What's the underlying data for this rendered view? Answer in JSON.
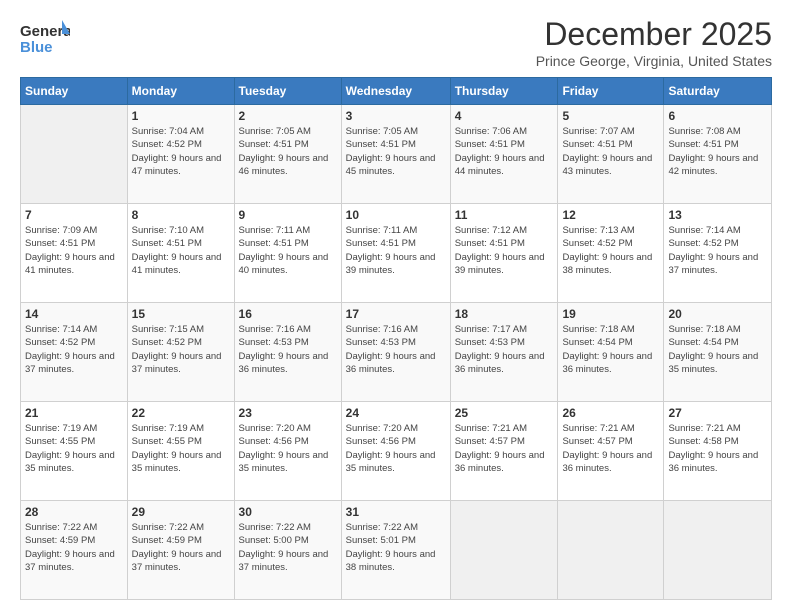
{
  "logo": {
    "line1": "General",
    "line2": "Blue"
  },
  "header": {
    "title": "December 2025",
    "subtitle": "Prince George, Virginia, United States"
  },
  "days_of_week": [
    "Sunday",
    "Monday",
    "Tuesday",
    "Wednesday",
    "Thursday",
    "Friday",
    "Saturday"
  ],
  "weeks": [
    [
      {
        "day": "",
        "empty": true
      },
      {
        "day": "1",
        "sunrise": "7:04 AM",
        "sunset": "4:52 PM",
        "daylight": "9 hours and 47 minutes."
      },
      {
        "day": "2",
        "sunrise": "7:05 AM",
        "sunset": "4:51 PM",
        "daylight": "9 hours and 46 minutes."
      },
      {
        "day": "3",
        "sunrise": "7:05 AM",
        "sunset": "4:51 PM",
        "daylight": "9 hours and 45 minutes."
      },
      {
        "day": "4",
        "sunrise": "7:06 AM",
        "sunset": "4:51 PM",
        "daylight": "9 hours and 44 minutes."
      },
      {
        "day": "5",
        "sunrise": "7:07 AM",
        "sunset": "4:51 PM",
        "daylight": "9 hours and 43 minutes."
      },
      {
        "day": "6",
        "sunrise": "7:08 AM",
        "sunset": "4:51 PM",
        "daylight": "9 hours and 42 minutes."
      }
    ],
    [
      {
        "day": "7",
        "sunrise": "7:09 AM",
        "sunset": "4:51 PM",
        "daylight": "9 hours and 41 minutes."
      },
      {
        "day": "8",
        "sunrise": "7:10 AM",
        "sunset": "4:51 PM",
        "daylight": "9 hours and 41 minutes."
      },
      {
        "day": "9",
        "sunrise": "7:11 AM",
        "sunset": "4:51 PM",
        "daylight": "9 hours and 40 minutes."
      },
      {
        "day": "10",
        "sunrise": "7:11 AM",
        "sunset": "4:51 PM",
        "daylight": "9 hours and 39 minutes."
      },
      {
        "day": "11",
        "sunrise": "7:12 AM",
        "sunset": "4:51 PM",
        "daylight": "9 hours and 39 minutes."
      },
      {
        "day": "12",
        "sunrise": "7:13 AM",
        "sunset": "4:52 PM",
        "daylight": "9 hours and 38 minutes."
      },
      {
        "day": "13",
        "sunrise": "7:14 AM",
        "sunset": "4:52 PM",
        "daylight": "9 hours and 37 minutes."
      }
    ],
    [
      {
        "day": "14",
        "sunrise": "7:14 AM",
        "sunset": "4:52 PM",
        "daylight": "9 hours and 37 minutes."
      },
      {
        "day": "15",
        "sunrise": "7:15 AM",
        "sunset": "4:52 PM",
        "daylight": "9 hours and 37 minutes."
      },
      {
        "day": "16",
        "sunrise": "7:16 AM",
        "sunset": "4:53 PM",
        "daylight": "9 hours and 36 minutes."
      },
      {
        "day": "17",
        "sunrise": "7:16 AM",
        "sunset": "4:53 PM",
        "daylight": "9 hours and 36 minutes."
      },
      {
        "day": "18",
        "sunrise": "7:17 AM",
        "sunset": "4:53 PM",
        "daylight": "9 hours and 36 minutes."
      },
      {
        "day": "19",
        "sunrise": "7:18 AM",
        "sunset": "4:54 PM",
        "daylight": "9 hours and 36 minutes."
      },
      {
        "day": "20",
        "sunrise": "7:18 AM",
        "sunset": "4:54 PM",
        "daylight": "9 hours and 35 minutes."
      }
    ],
    [
      {
        "day": "21",
        "sunrise": "7:19 AM",
        "sunset": "4:55 PM",
        "daylight": "9 hours and 35 minutes."
      },
      {
        "day": "22",
        "sunrise": "7:19 AM",
        "sunset": "4:55 PM",
        "daylight": "9 hours and 35 minutes."
      },
      {
        "day": "23",
        "sunrise": "7:20 AM",
        "sunset": "4:56 PM",
        "daylight": "9 hours and 35 minutes."
      },
      {
        "day": "24",
        "sunrise": "7:20 AM",
        "sunset": "4:56 PM",
        "daylight": "9 hours and 35 minutes."
      },
      {
        "day": "25",
        "sunrise": "7:21 AM",
        "sunset": "4:57 PM",
        "daylight": "9 hours and 36 minutes."
      },
      {
        "day": "26",
        "sunrise": "7:21 AM",
        "sunset": "4:57 PM",
        "daylight": "9 hours and 36 minutes."
      },
      {
        "day": "27",
        "sunrise": "7:21 AM",
        "sunset": "4:58 PM",
        "daylight": "9 hours and 36 minutes."
      }
    ],
    [
      {
        "day": "28",
        "sunrise": "7:22 AM",
        "sunset": "4:59 PM",
        "daylight": "9 hours and 37 minutes."
      },
      {
        "day": "29",
        "sunrise": "7:22 AM",
        "sunset": "4:59 PM",
        "daylight": "9 hours and 37 minutes."
      },
      {
        "day": "30",
        "sunrise": "7:22 AM",
        "sunset": "5:00 PM",
        "daylight": "9 hours and 37 minutes."
      },
      {
        "day": "31",
        "sunrise": "7:22 AM",
        "sunset": "5:01 PM",
        "daylight": "9 hours and 38 minutes."
      },
      {
        "day": "",
        "empty": true
      },
      {
        "day": "",
        "empty": true
      },
      {
        "day": "",
        "empty": true
      }
    ]
  ],
  "labels": {
    "sunrise_prefix": "Sunrise: ",
    "sunset_prefix": "Sunset: ",
    "daylight_prefix": "Daylight: "
  }
}
